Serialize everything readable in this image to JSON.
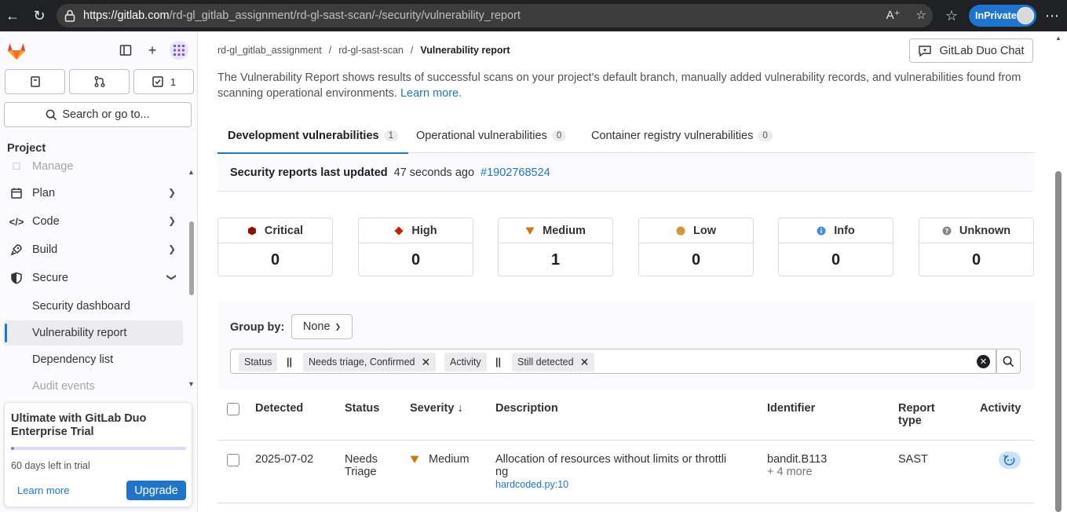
{
  "browser": {
    "url_host": "https://gitlab.com",
    "url_path": "/rd-gl_gitlab_assignment/rd-gl-sast-scan/-/security/vulnerability_report",
    "inprivate_label": "InPrivate"
  },
  "sidebar": {
    "todo_count": "1",
    "search_label": "Search or go to...",
    "section_title": "Project",
    "items": [
      {
        "label": "Manage"
      },
      {
        "label": "Plan"
      },
      {
        "label": "Code"
      },
      {
        "label": "Build"
      },
      {
        "label": "Secure"
      }
    ],
    "sub_items": [
      {
        "label": "Security dashboard"
      },
      {
        "label": "Vulnerability report"
      },
      {
        "label": "Dependency list"
      },
      {
        "label": "Audit events"
      }
    ],
    "trial": {
      "title": "Ultimate with GitLab Duo Enterprise Trial",
      "progress_fraction": 0.02,
      "days_left": "60 days left in trial",
      "learn_more": "Learn more",
      "upgrade": "Upgrade"
    }
  },
  "breadcrumb": {
    "group": "rd-gl_gitlab_assignment",
    "project": "rd-gl-sast-scan",
    "current": "Vulnerability report",
    "separator": "/"
  },
  "duo_chat_label": "GitLab Duo Chat",
  "intro": {
    "text": "The Vulnerability Report shows results of successful scans on your project's default branch, manually added vulnerability records, and vulnerabilities found from scanning operational environments.",
    "link": "Learn more."
  },
  "tabs": [
    {
      "label": "Development vulnerabilities",
      "count": "1"
    },
    {
      "label": "Operational vulnerabilities",
      "count": "0"
    },
    {
      "label": "Container registry vulnerabilities",
      "count": "0"
    }
  ],
  "last_updated": {
    "label": "Security reports last updated",
    "time": "47 seconds ago",
    "pipeline": "#1902768524"
  },
  "severity_cards": [
    {
      "label": "Critical",
      "value": "0",
      "color": "#8d1300"
    },
    {
      "label": "High",
      "value": "0",
      "color": "#c91c00"
    },
    {
      "label": "Medium",
      "value": "1",
      "color": "#c17d10"
    },
    {
      "label": "Low",
      "value": "0",
      "color": "#d99530"
    },
    {
      "label": "Info",
      "value": "0",
      "color": "#428fdc"
    },
    {
      "label": "Unknown",
      "value": "0",
      "color": "#868686"
    }
  ],
  "filters": {
    "group_by_label": "Group by:",
    "group_by_value": "None",
    "tokens": {
      "status_key": "Status",
      "operator": "||",
      "status_value": "Needs triage, Confirmed",
      "activity_key": "Activity",
      "activity_value": "Still detected"
    }
  },
  "table": {
    "headers": {
      "detected": "Detected",
      "status": "Status",
      "severity": "Severity",
      "sort_arrow": "↓",
      "description": "Description",
      "identifier": "Identifier",
      "report_type_line1": "Report",
      "report_type_line2": "type",
      "activity": "Activity"
    },
    "rows": [
      {
        "detected": "2025-07-02",
        "status_line1": "Needs",
        "status_line2": "Triage",
        "severity": "Medium",
        "description_line1": "Allocation of resources without limits or throttli",
        "description_line2": "ng",
        "file": "hardcoded.py:10",
        "identifier": "bandit.B113",
        "identifier_more": "+ 4 more",
        "report_type": "SAST"
      }
    ]
  }
}
